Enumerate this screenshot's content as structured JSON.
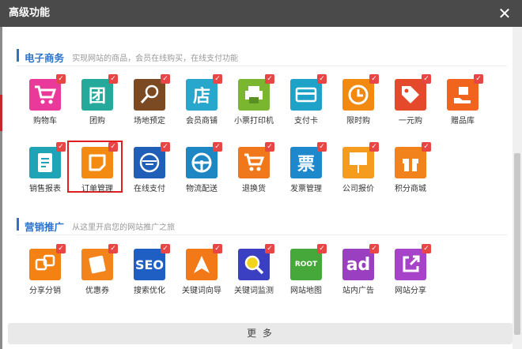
{
  "dialog": {
    "title": "高级功能",
    "close_glyph": "✕",
    "more_label": "更 多"
  },
  "sections": [
    {
      "title": "电子商务",
      "desc": "实现网站的商品，会员在线购买，在线支付功能",
      "items": [
        {
          "label": "购物车",
          "color": "#e9399a",
          "icon": "cart-icon"
        },
        {
          "label": "团购",
          "color": "#25a99a",
          "icon": "group-buy-icon"
        },
        {
          "label": "场地预定",
          "color": "#7b4a22",
          "icon": "venue-icon"
        },
        {
          "label": "会员商铺",
          "color": "#27a7cc",
          "icon": "shop-icon"
        },
        {
          "label": "小票打印机",
          "color": "#7ab62f",
          "icon": "printer-icon"
        },
        {
          "label": "支付卡",
          "color": "#1ea2c8",
          "icon": "card-icon"
        },
        {
          "label": "限时购",
          "color": "#f28a12",
          "icon": "clock-icon"
        },
        {
          "label": "一元购",
          "color": "#e5492c",
          "icon": "tag-icon"
        },
        {
          "label": "赠品库",
          "color": "#f0641d",
          "icon": "gift-hand-icon"
        },
        {
          "label": "销售报表",
          "color": "#1fa4b7",
          "icon": "report-icon"
        },
        {
          "label": "订单管理",
          "color": "#f38b12",
          "icon": "order-icon",
          "selected": true
        },
        {
          "label": "在线支付",
          "color": "#1f5fb7",
          "icon": "payment-icon"
        },
        {
          "label": "物流配送",
          "color": "#1f86c4",
          "icon": "wheel-icon"
        },
        {
          "label": "退换货",
          "color": "#f0781b",
          "icon": "return-cart-icon"
        },
        {
          "label": "发票管理",
          "color": "#1e88cd",
          "icon": "invoice-icon"
        },
        {
          "label": "公司报价",
          "color": "#f59b1d",
          "icon": "quote-icon"
        },
        {
          "label": "积分商城",
          "color": "#f2821c",
          "icon": "points-gift-icon"
        }
      ]
    },
    {
      "title": "营销推广",
      "desc": "从这里开启您的网站推广之旅",
      "items": [
        {
          "label": "分享分销",
          "color": "#f38213",
          "icon": "share-dist-icon"
        },
        {
          "label": "优惠券",
          "color": "#f3841b",
          "icon": "coupon-icon"
        },
        {
          "label": "搜索优化",
          "color": "#1f5fc4",
          "icon": "seo-icon"
        },
        {
          "label": "关键词向导",
          "color": "#f27818",
          "icon": "arrow-nav-icon"
        },
        {
          "label": "关键词监测",
          "color": "#3b3fc1",
          "icon": "magnifier-icon"
        },
        {
          "label": "网站地图",
          "color": "#46a83a",
          "icon": "sitemap-icon"
        },
        {
          "label": "站内广告",
          "color": "#9a3fc0",
          "icon": "ad-icon"
        },
        {
          "label": "网站分享",
          "color": "#a743c8",
          "icon": "share-icon"
        }
      ]
    }
  ],
  "icon_text": {
    "group-buy-icon": "团",
    "shop-icon": "店",
    "invoice-icon": "票",
    "seo-icon": "SEO",
    "ad-icon": "ad",
    "sitemap-icon": "ROOT"
  }
}
